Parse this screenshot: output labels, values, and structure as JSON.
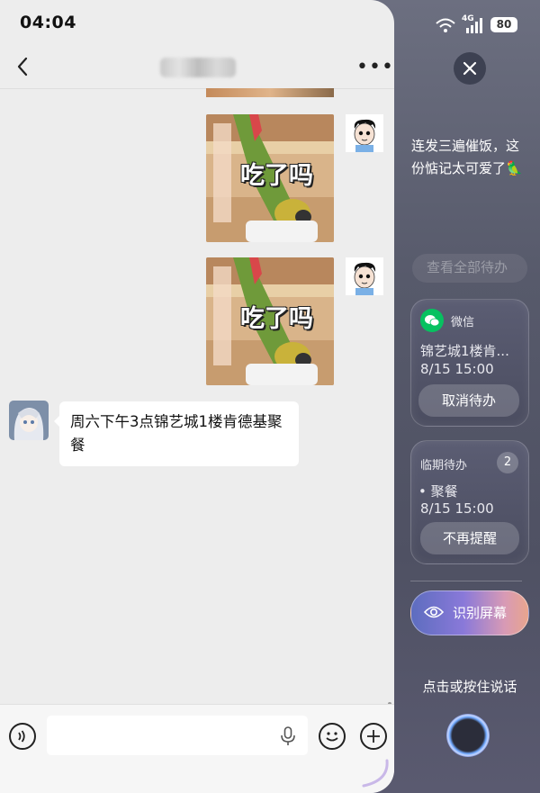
{
  "status_bar": {
    "time": "04:04",
    "signal_label": "4G",
    "battery": "80"
  },
  "chat": {
    "contact_name": "**** ****",
    "messages": [
      {
        "type": "sticker",
        "sender": "me",
        "text": "吃了吗"
      },
      {
        "type": "sticker",
        "sender": "me",
        "text": "吃了吗"
      },
      {
        "type": "text",
        "sender": "friend",
        "text": "周六下午3点锦艺城1楼肯德基聚餐"
      }
    ]
  },
  "assistant": {
    "suggestion": "连发三遍催饭，这份惦记太可爱了🦜",
    "faded_button": "查看全部待办",
    "wechat_card": {
      "app": "微信",
      "title": "锦艺城1楼肯...",
      "time": "8/15 15:00",
      "action": "取消待办"
    },
    "upcoming_card": {
      "title": "临期待办",
      "count": "2",
      "item": "• 聚餐",
      "time": "8/15 15:00",
      "action": "不再提醒"
    },
    "recognize_label": "识别屏幕",
    "voice_hint": "点击或按住说话"
  }
}
